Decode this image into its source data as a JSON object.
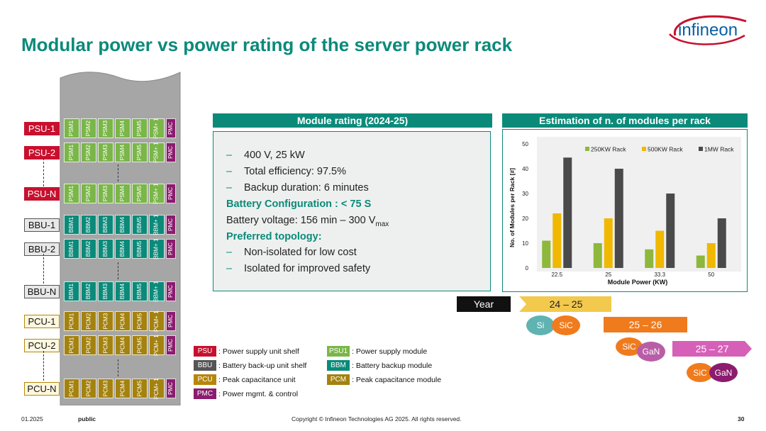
{
  "title": "Modular power vs power rating of the server power rack",
  "logo": {
    "text": "infineon"
  },
  "rack": {
    "shelves": [
      {
        "label": "PSU-1",
        "type": "psu",
        "modules": [
          "PSM1",
          "PSM2",
          "PSM3",
          "PSM4",
          "PSM5",
          "PSM+ 1"
        ],
        "pmc": "PMC"
      },
      {
        "label": "PSU-2",
        "type": "psu",
        "modules": [
          "PSM1",
          "PSM2",
          "PSM3",
          "PSM4",
          "PSM5",
          "PSM+ 1"
        ],
        "pmc": "PMC"
      },
      {
        "label": "PSU-N",
        "type": "psu",
        "modules": [
          "PSM1",
          "PSM2",
          "PSM3",
          "PSM4",
          "PSM5",
          "PSM+ 1"
        ],
        "pmc": "PMC"
      },
      {
        "label": "BBU-1",
        "type": "bbu",
        "modules": [
          "BBM1",
          "BBM2",
          "BBM3",
          "BBM4",
          "BBM5",
          "BBM+ 1"
        ],
        "pmc": "PMC"
      },
      {
        "label": "BBU-2",
        "type": "bbu",
        "modules": [
          "BBM1",
          "BBM2",
          "BBM3",
          "BBM4",
          "BBM5",
          "BBM+ 1"
        ],
        "pmc": "PMC"
      },
      {
        "label": "BBU-N",
        "type": "bbu",
        "modules": [
          "BBM1",
          "BBM2",
          "BBM3",
          "BBM4",
          "BBM5",
          "BBM+ 1"
        ],
        "pmc": "PMC"
      },
      {
        "label": "PCU-1",
        "type": "pcu",
        "modules": [
          "PCM1",
          "PCM2",
          "PCM3",
          "PCM4",
          "PCM5",
          "PCM+ 1"
        ],
        "pmc": "PMC"
      },
      {
        "label": "PCU-2",
        "type": "pcu",
        "modules": [
          "PCM1",
          "PCM2",
          "PCM3",
          "PCM4",
          "PCM5",
          "PCM+ 1"
        ],
        "pmc": "PMC"
      },
      {
        "label": "PCU-N",
        "type": "pcu",
        "modules": [
          "PCM1",
          "PCM2",
          "PCM3",
          "PCM4",
          "PCM5",
          "PCM+ 1"
        ],
        "pmc": "PMC"
      }
    ]
  },
  "colors": {
    "teal": "#0b8a7a",
    "psu": "#c8102e",
    "bbu": "#555555",
    "pcu": "#b8860b",
    "psm": "#7ab648",
    "bbm": "#0b8a7a",
    "pcm": "#a4820f",
    "pmc": "#8b1c6e"
  },
  "module_rating": {
    "header": "Module rating (2024-25)",
    "bullets1": [
      "400 V, 25 kW",
      "Total efficiency: 97.5%",
      "Backup duration: 6 minutes"
    ],
    "battery_config": "Battery Configuration : < 75 S",
    "battery_voltage": "Battery voltage: 156 min – 300 V",
    "battery_voltage_sub": "max",
    "preferred": "Preferred topology:",
    "bullets2": [
      "Non-isolated for low cost",
      "Isolated for improved safety"
    ],
    "dash": "–"
  },
  "chart_header": "Estimation of n. of modules per rack",
  "chart_data": {
    "type": "bar",
    "categories": [
      "22.5",
      "25",
      "33.3",
      "50"
    ],
    "series": [
      {
        "name": "250KW Rack",
        "values": [
          11,
          10,
          7.5,
          5
        ],
        "color": "#8db83c"
      },
      {
        "name": "500KW Rack",
        "values": [
          22,
          20,
          15,
          10
        ],
        "color": "#f0b800"
      },
      {
        "name": "1MW Rack",
        "values": [
          44.5,
          40,
          30,
          20
        ],
        "color": "#4a4a4a"
      }
    ],
    "xlabel": "Module Power (KW)",
    "ylabel": "No. of Modules per Rack [#]",
    "ylim": [
      0,
      50
    ],
    "yticks": [
      "0",
      "10",
      "20",
      "30",
      "40",
      "50"
    ],
    "legend_position": "top",
    "grid": false
  },
  "legend": [
    {
      "tag": "PSU",
      "text": ": Power supply unit shelf",
      "color": "#c8102e"
    },
    {
      "tag": "BBU",
      "text": ": Battery back-up unit shelf",
      "color": "#555555"
    },
    {
      "tag": "PCU",
      "text": ": Peak capacitance unit",
      "color": "#b8860b"
    },
    {
      "tag": "PMC",
      "text": ": Power mgmt. & control",
      "color": "#8b1c6e"
    },
    {
      "tag": "PSU1",
      "text": ": Power supply module",
      "color": "#7ab648"
    },
    {
      "tag": "BBM",
      "text": ": Battery backup module",
      "color": "#0b8a7a"
    },
    {
      "tag": "PCM",
      "text": ": Peak capacitance module",
      "color": "#a4820f"
    }
  ],
  "timeline": {
    "year_label": "Year",
    "periods": [
      "24 – 25",
      "25 – 26",
      "25 – 27"
    ],
    "tech1": [
      "Si",
      "SiC"
    ],
    "tech2": [
      "SiC",
      "GaN"
    ],
    "tech3": [
      "SiC",
      "GaN"
    ]
  },
  "footer": {
    "date": "01.2025",
    "classification": "public",
    "copyright": "Copyright © Infineon Technologies AG 2025. All rights reserved.",
    "page": "30"
  }
}
